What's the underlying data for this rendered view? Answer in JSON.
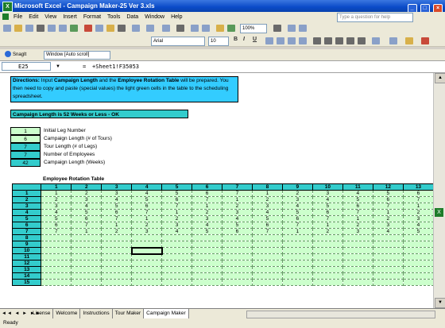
{
  "window": {
    "title": "Microsoft Excel - Campaign Maker-25 Ver 3.xls",
    "icon": "X"
  },
  "menu": [
    "File",
    "Edit",
    "View",
    "Insert",
    "Format",
    "Tools",
    "Data",
    "Window",
    "Help"
  ],
  "question_placeholder": "Type a question for help",
  "toolbar": {
    "zoom": "100%",
    "font": "Arial",
    "font_size": "10"
  },
  "snagit": {
    "label": "SnagIt",
    "window_select": "Window [Auto scroll]"
  },
  "formula_bar": {
    "cell": "E25",
    "fx": "=",
    "formula": "+Sheet1!F35053"
  },
  "directions": {
    "lead": "Directions:",
    "t1": " Input ",
    "b1": "Campaign Length",
    "t2": " and the ",
    "b2": "Employee Rotation Table",
    "t3": " will be prepared.  You then need to copy and paste (special values) the light green cells in the table to the scheduling spreadsheet."
  },
  "campaign_status": "Campaign Length is 52 Weeks or Less - OK",
  "params": [
    {
      "value": "1",
      "label": "Initial Leg Number",
      "style": "green"
    },
    {
      "value": "6",
      "label": "Campaign Length (# of Tours)",
      "style": "green"
    },
    {
      "value": "7",
      "label": "Tour Length (# of Legs)",
      "style": "blue"
    },
    {
      "value": "7",
      "label": "Number of Employees",
      "style": "blue"
    },
    {
      "value": "42",
      "label": "Campaign Length (Weeks)",
      "style": "blue"
    }
  ],
  "rotation_table": {
    "title": "Employee Rotation Table",
    "columns": [
      "1",
      "2",
      "3",
      "4",
      "5",
      "6",
      "7",
      "8",
      "9",
      "10",
      "11",
      "12",
      "13"
    ],
    "row_labels": [
      "1",
      "2",
      "3",
      "4",
      "5",
      "6",
      "7",
      "8",
      "9",
      "10",
      "11",
      "12",
      "13",
      "14",
      "15"
    ],
    "rows": [
      [
        "1",
        "2",
        "3",
        "4",
        "5",
        "6",
        "7",
        "1",
        "2",
        "3",
        "4",
        "5",
        "6"
      ],
      [
        "2",
        "3",
        "4",
        "5",
        "6",
        "7",
        "1",
        "2",
        "3",
        "4",
        "5",
        "6",
        "7"
      ],
      [
        "3",
        "4",
        "5",
        "6",
        "7",
        "1",
        "2",
        "3",
        "4",
        "5",
        "6",
        "7",
        "1"
      ],
      [
        "4",
        "5",
        "6",
        "7",
        "1",
        "2",
        "3",
        "4",
        "5",
        "6",
        "7",
        "1",
        "2"
      ],
      [
        "5",
        "6",
        "7",
        "1",
        "2",
        "3",
        "4",
        "5",
        "6",
        "7",
        "1",
        "2",
        "3"
      ],
      [
        "6",
        "7",
        "1",
        "2",
        "3",
        "4",
        "5",
        "6",
        "7",
        "1",
        "2",
        "3",
        "4"
      ],
      [
        "7",
        "1",
        "2",
        "3",
        "4",
        "5",
        "6",
        "7",
        "1",
        "2",
        "3",
        "4",
        "5"
      ],
      [],
      [],
      [],
      [],
      [],
      [],
      [],
      []
    ],
    "selected": {
      "row": 9,
      "col": 3
    }
  },
  "sheet_tabs": [
    "License",
    "Welcome",
    "Instructions",
    "Tour Maker",
    "Campaign Maker"
  ],
  "active_tab": "Campaign Maker",
  "status": "Ready"
}
